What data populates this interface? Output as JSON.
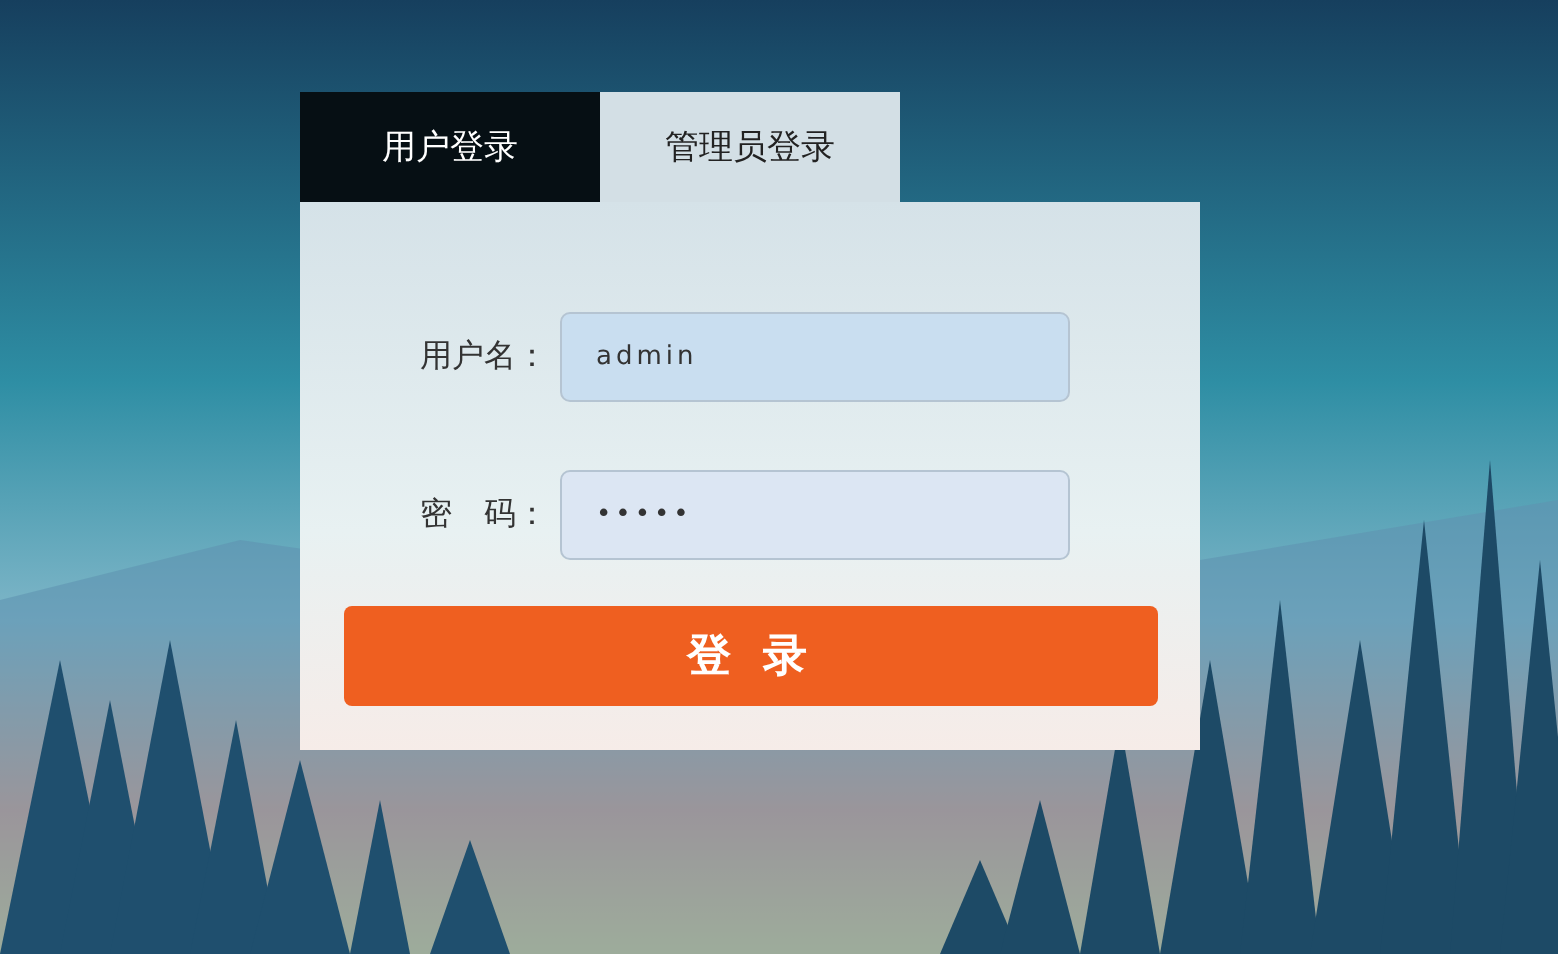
{
  "tabs": [
    {
      "label": "用户登录",
      "selected": false
    },
    {
      "label": "管理员登录",
      "selected": true
    }
  ],
  "form": {
    "fields": [
      {
        "label": "用户名：",
        "value": "admin"
      },
      {
        "label": "密　码：",
        "value": "•••••"
      }
    ],
    "submit": "登 录"
  }
}
